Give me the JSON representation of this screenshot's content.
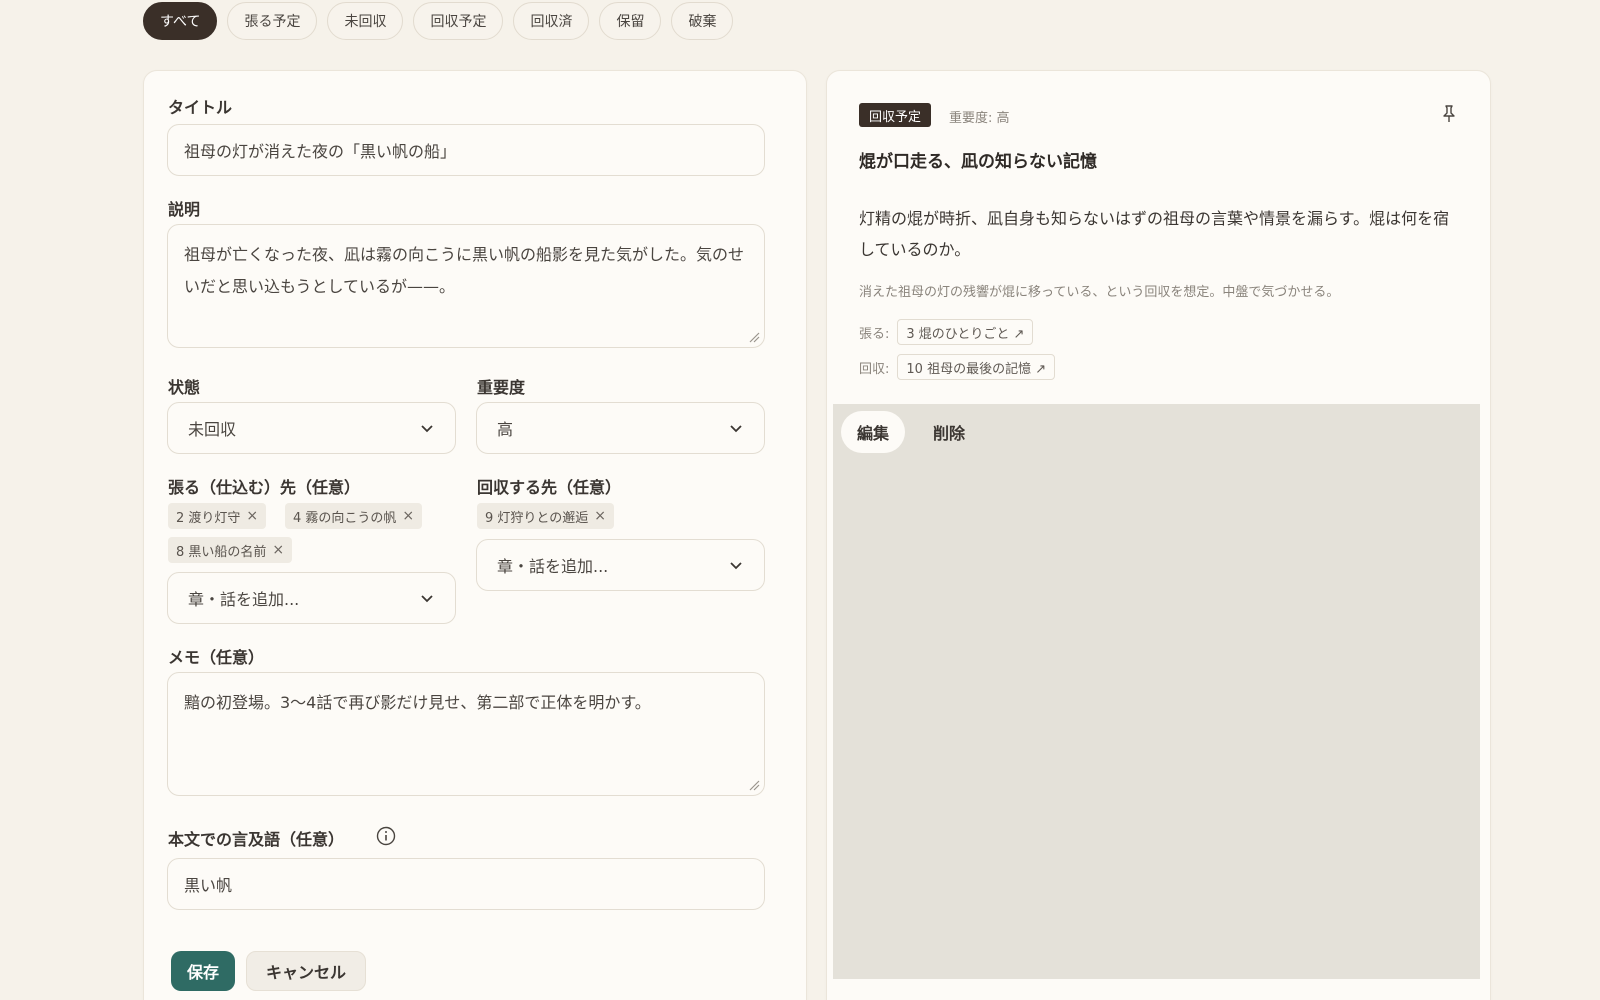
{
  "filters": [
    "すべて",
    "張る予定",
    "未回収",
    "回収予定",
    "回収済",
    "保留",
    "破棄"
  ],
  "form": {
    "title_label": "タイトル",
    "title_value": "祖母の灯が消えた夜の「黒い帆の船」",
    "desc_label": "説明",
    "desc_value": "祖母が亡くなった夜、凪は霧の向こうに黒い帆の船影を見た気がした。気のせいだと思い込もうとしているが——。",
    "status_label": "状態",
    "status_value": "未回収",
    "importance_label": "重要度",
    "importance_value": "高",
    "plant_label": "張る（仕込む）先（任意）",
    "plant_tags": [
      "2 渡り灯守",
      "4 霧の向こうの帆",
      "8 黒い船の名前"
    ],
    "plant_add_placeholder": "章・話を追加...",
    "payoff_label": "回収する先（任意）",
    "payoff_tags": [
      "9 灯狩りとの邂逅"
    ],
    "payoff_add_placeholder": "章・話を追加...",
    "memo_label": "メモ（任意）",
    "memo_value": "黯の初登場。3〜4話で再び影だけ見せ、第二部で正体を明かす。",
    "mention_label": "本文での言及語（任意）",
    "mention_value": "黒い帆",
    "save_label": "保存",
    "cancel_label": "キャンセル",
    "tag_remove": "×"
  },
  "detail": {
    "status": "回収予定",
    "importance": "重要度: 高",
    "title": "焜が口走る、凪の知らない記憶",
    "description": "灯精の焜が時折、凪自身も知らないはずの祖母の言葉や情景を漏らす。焜は何を宿しているのか。",
    "memo": "消えた祖母の灯の残響が焜に移っている、という回収を想定。中盤で気づかせる。",
    "plant_prefix": "張る:",
    "plant_link": "3 焜のひとりごと ↗",
    "payoff_prefix": "回収:",
    "payoff_link": "10 祖母の最後の記憶 ↗",
    "edit_label": "編集",
    "delete_label": "削除"
  },
  "icons": {
    "pin": "pin-icon",
    "info": "info-icon",
    "chevron": "chevron-down-icon",
    "resize": "resize-handle-icon"
  },
  "colors": {
    "accent": "#2f6b64",
    "dark_chip": "#3a2f28",
    "background": "#f6f2ea"
  }
}
